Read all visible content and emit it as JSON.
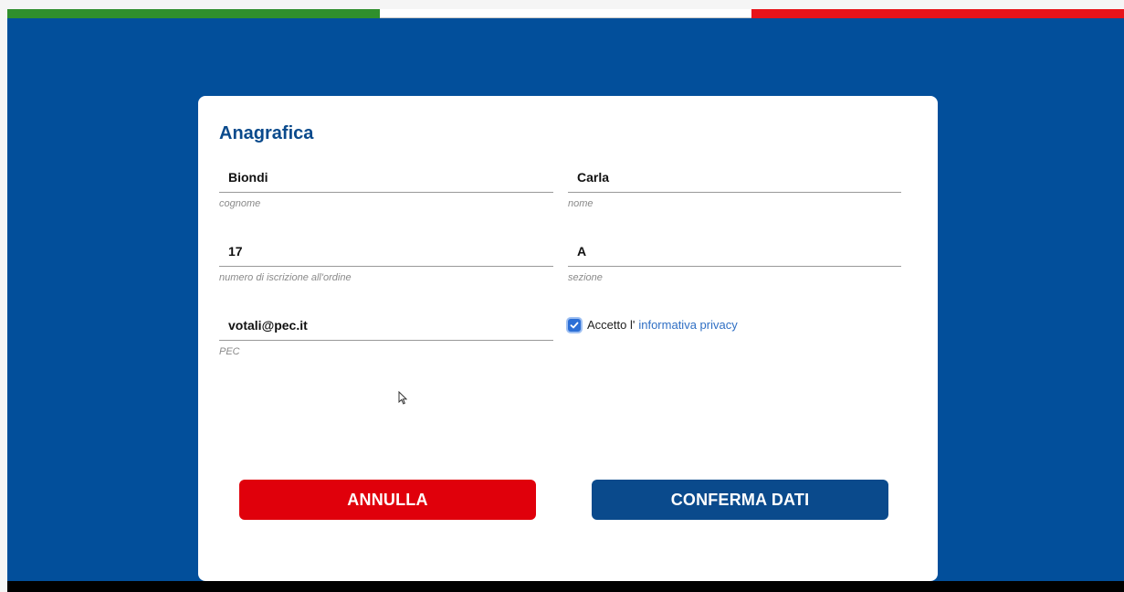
{
  "form": {
    "title": "Anagrafica",
    "fields": [
      {
        "value": "Biondi",
        "label": "cognome"
      },
      {
        "value": "Carla",
        "label": "nome"
      },
      {
        "value": "17",
        "label": "numero di iscrizione all'ordine"
      },
      {
        "value": "A",
        "label": "sezione"
      },
      {
        "value": "votali@pec.it",
        "label": "PEC"
      }
    ],
    "privacy": {
      "checked": true,
      "text": "Accetto l'",
      "link": "informativa privacy"
    },
    "buttons": {
      "cancel": "ANNULLA",
      "confirm": "CONFERMA DATI"
    }
  },
  "colors": {
    "background": "#024f9b",
    "title": "#0a4a8c",
    "cancel": "#e0000b",
    "confirm": "#0a4a8c",
    "link": "#2f6fc4"
  },
  "icons": [
    "checkmark-icon",
    "mouse-cursor-icon"
  ]
}
